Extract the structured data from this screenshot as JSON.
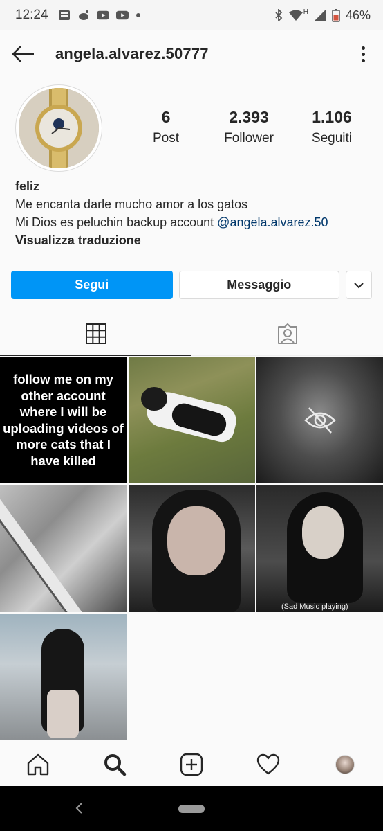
{
  "status_bar": {
    "time": "12:24",
    "left_icons": [
      "news-icon",
      "reddit-icon",
      "youtube-icon",
      "youtube-icon",
      "dot-icon"
    ],
    "right_icons": [
      "bluetooth-icon",
      "wifi-icon",
      "signal-icon",
      "battery-icon"
    ],
    "network": "H",
    "battery": "46%"
  },
  "header": {
    "username": "angela.alvarez.50777"
  },
  "profile": {
    "stats": [
      {
        "value": "6",
        "label": "Post"
      },
      {
        "value": "2.393",
        "label": "Follower"
      },
      {
        "value": "1.106",
        "label": "Seguiti"
      }
    ],
    "bio": {
      "name": "feliz",
      "line1": "Me encanta darle mucho amor a los gatos",
      "line2_prefix": "Mi Dios es peluchin backup account ",
      "mention": "@angela.alvarez.50",
      "translate": "Visualizza traduzione"
    }
  },
  "actions": {
    "follow_label": "Segui",
    "message_label": "Messaggio"
  },
  "tabs": [
    {
      "name": "grid",
      "icon": "grid-icon",
      "active": true
    },
    {
      "name": "tagged",
      "icon": "tagged-person-icon",
      "active": false
    }
  ],
  "posts": [
    {
      "kind": "text",
      "text": "follow me on my other account where I will be uploading videos of more cats that I have killed"
    },
    {
      "kind": "photo",
      "subject": "cat on grass"
    },
    {
      "kind": "hidden",
      "icon": "eye-slash-icon"
    },
    {
      "kind": "photo",
      "subject": "grey water"
    },
    {
      "kind": "photo",
      "subject": "girl with dog filter"
    },
    {
      "kind": "photo",
      "subject": "girl with dog filter",
      "caption": "(Sad Music playing)"
    },
    {
      "kind": "photo",
      "subject": "girl standing outdoors"
    }
  ],
  "bottom_nav": [
    "home-icon",
    "search-icon",
    "add-post-icon",
    "heart-icon",
    "profile-avatar"
  ],
  "colors": {
    "accent": "#0095f6",
    "text": "#262626",
    "link": "#00376b",
    "background": "#fafafa",
    "border": "#dbdbdb"
  }
}
